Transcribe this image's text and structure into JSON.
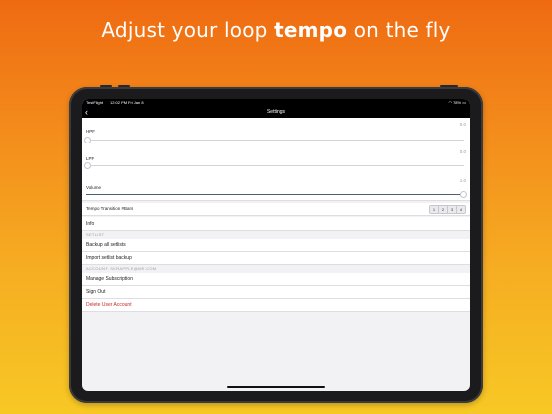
{
  "headline": {
    "prefix": "Adjust your loop",
    "bold": "tempo",
    "suffix": "on the fly"
  },
  "status_bar": {
    "carrier": "TestFlight",
    "time": "12:02 PM",
    "date": "Fri Jan 8",
    "battery": "78%"
  },
  "nav": {
    "back_glyph": "‹",
    "title": "Settings"
  },
  "sliders": [
    {
      "label": "HPF",
      "value": "0.0",
      "level": 0.0
    },
    {
      "label": "LPF",
      "value": "0.0",
      "level": 0.0
    },
    {
      "label": "Volume",
      "value": "1.0",
      "level": 1.0
    }
  ],
  "tempo": {
    "label": "Tempo Transition #Bars",
    "options": [
      "1",
      "2",
      "3",
      "4"
    ]
  },
  "info": {
    "label": "Info"
  },
  "setlist_section": {
    "header": "SETLIST",
    "items": [
      "Backup all setlists",
      "Import setlist backup"
    ]
  },
  "account_section": {
    "header": "ACCOUNT: SKRAPPLE@ME.COM",
    "items": [
      "Manage Subscription",
      "Sign Out"
    ],
    "danger_item": "Delete User Account"
  },
  "colors": {
    "accent": "#4a6079",
    "danger": "#c62828",
    "background_top": "#ef6a12",
    "background_bottom": "#f7c824"
  }
}
